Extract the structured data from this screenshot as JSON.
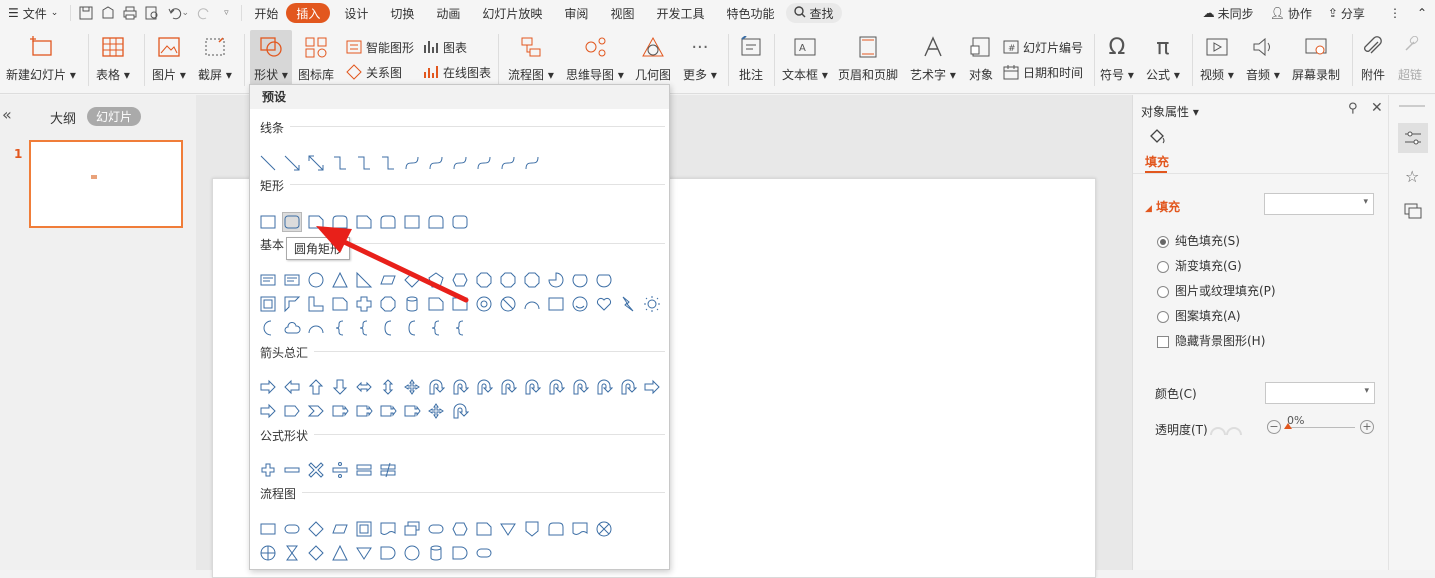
{
  "menu": {
    "file": "文件",
    "tabs": [
      "开始",
      "插入",
      "设计",
      "切换",
      "动画",
      "幻灯片放映",
      "审阅",
      "视图",
      "开发工具",
      "特色功能"
    ],
    "active_tab": "插入",
    "search": "查找",
    "unsync": "未同步",
    "collab": "协作",
    "share": "分享"
  },
  "ribbon": {
    "new_slide": "新建幻灯片",
    "table": "表格",
    "picture": "图片",
    "screenshot": "截屏",
    "shape": "形状",
    "gallery": "图标库",
    "smart_art": "智能图形",
    "chart": "图表",
    "relation": "关系图",
    "online_chart": "在线图表",
    "flowchart": "流程图",
    "mindmap": "思维导图",
    "geometry": "几何图",
    "more": "更多",
    "comment": "批注",
    "textbox": "文本框",
    "header_footer": "页眉和页脚",
    "wordart": "艺术字",
    "object": "对象",
    "slide_number": "幻灯片编号",
    "datetime": "日期和时间",
    "symbol": "符号",
    "formula": "公式",
    "video": "视频",
    "audio": "音频",
    "screen_record": "屏幕录制",
    "attachment": "附件",
    "hyperlink": "超链"
  },
  "left_pane": {
    "outline": "大纲",
    "slides": "幻灯片",
    "slide_num": "1"
  },
  "dropdown": {
    "header": "预设",
    "sections": [
      "线条",
      "矩形",
      "基本",
      "箭头总汇",
      "公式形状",
      "流程图"
    ],
    "tooltip": "圆角矩形"
  },
  "props": {
    "title": "对象属性",
    "tab_fill": "填充",
    "fill_section": "填充",
    "options": [
      "纯色填充(S)",
      "渐变填充(G)",
      "图片或纹理填充(P)",
      "图案填充(A)"
    ],
    "hide_bg": "隐藏背景图形(H)",
    "color": "颜色(C)",
    "transparency": "透明度(T)",
    "transparency_value": "0%"
  },
  "colors": {
    "accent": "#e2571e",
    "arrow": "#e8201a",
    "selection": "#f07d39",
    "icon": "#3c6ea5"
  }
}
